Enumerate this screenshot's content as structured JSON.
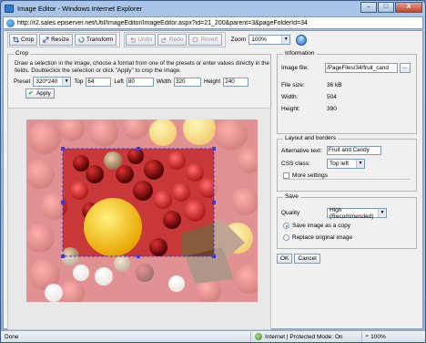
{
  "window": {
    "title": "Image Editor - Windows Internet Explorer",
    "minimize": "–",
    "maximize": "□",
    "close": "X"
  },
  "address": {
    "url": "http://r2.sales.episerver.net/Util/ImageEditor/ImageEditor.aspx?id=21_200&parent=3&pageFolderId=34"
  },
  "toolbar": {
    "crop": "Crop",
    "resize": "Resize",
    "transform": "Transform",
    "undo": "Undo",
    "redo": "Redo",
    "revert": "Revert",
    "zoom_label": "Zoom",
    "zoom_value": "100%"
  },
  "crop": {
    "legend": "Crop",
    "instructions": "Draw a selection in the image, choose a format from one of the presets or enter values directly in the fields. Doubleclick the selection or click \"Apply\" to crop the image.",
    "preset_label": "Preset",
    "preset_value": "320*240",
    "top_label": "Top",
    "top_value": "64",
    "left_label": "Left",
    "left_value": "80",
    "width_label": "Width",
    "width_value": "320",
    "height_label": "Height",
    "height_value": "240",
    "apply": "Apply"
  },
  "information": {
    "legend": "Information",
    "image_file_label": "Image file:",
    "image_file_value": "/PageFiles/34/fruit_cand",
    "browse": "...",
    "file_size_label": "File size:",
    "file_size_value": "36 kB",
    "width_label": "Width:",
    "width_value": "504",
    "height_label": "Height:",
    "height_value": "390"
  },
  "layout": {
    "legend": "Layout and borders",
    "alt_label": "Alternative text:",
    "alt_value": "Fruit and Candy",
    "css_label": "CSS class:",
    "css_value": "Top left",
    "more_settings": "More settings"
  },
  "save": {
    "legend": "Save",
    "quality_label": "Quality",
    "quality_value": "High (Recommended)",
    "option_copy": "Save image as a copy",
    "option_replace": "Replace original image"
  },
  "actions": {
    "ok": "OK",
    "cancel": "Cancel"
  },
  "status": {
    "done": "Done",
    "zone": "Internet | Protected Mode: On",
    "zoom": "100%"
  }
}
